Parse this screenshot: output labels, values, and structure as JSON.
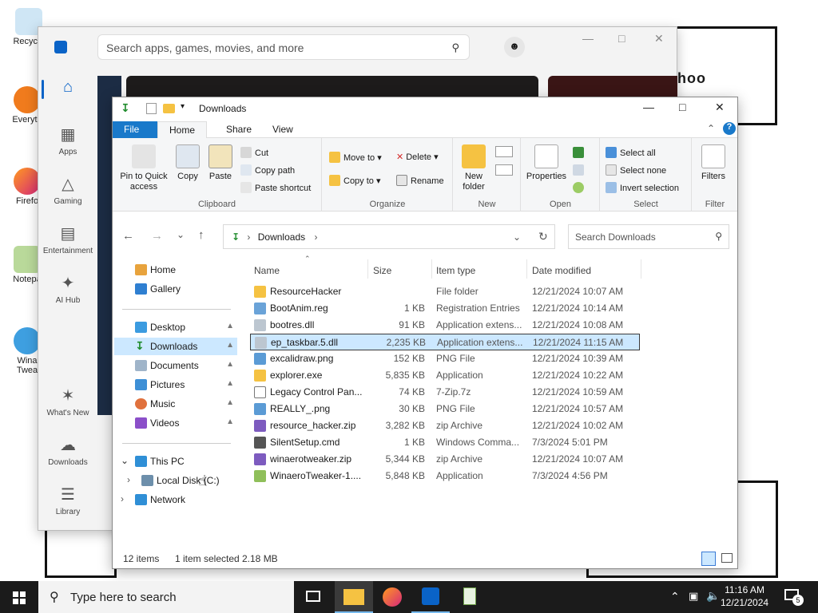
{
  "desktop": {
    "icons": [
      {
        "label": "Recycle",
        "icon": "recycle-bin-icon"
      },
      {
        "label": "Everyth",
        "icon": "everything-icon"
      },
      {
        "label": "Firefo",
        "icon": "firefox-icon"
      },
      {
        "label": "Notepa",
        "icon": "notepad-icon"
      },
      {
        "label": "Wina Twea",
        "icon": "winaero-icon"
      }
    ],
    "bg_text": "hoo"
  },
  "store": {
    "search_placeholder": "Search apps, games, movies, and more",
    "rail": [
      {
        "label": "",
        "icon": "home-icon"
      },
      {
        "label": "Apps",
        "icon": "apps-icon"
      },
      {
        "label": "Gaming",
        "icon": "gaming-icon"
      },
      {
        "label": "Entertainment",
        "icon": "entertainment-icon"
      },
      {
        "label": "AI Hub",
        "icon": "ai-hub-icon"
      },
      {
        "label": "What's New",
        "icon": "whats-new-icon"
      },
      {
        "label": "Downloads",
        "icon": "downloads-icon"
      },
      {
        "label": "Library",
        "icon": "library-icon"
      }
    ]
  },
  "explorer": {
    "title": "Downloads",
    "tabs": [
      "File",
      "Home",
      "Share",
      "View"
    ],
    "ribbon": {
      "clipboard": {
        "label": "Clipboard",
        "pin": "Pin to Quick access",
        "copy": "Copy",
        "paste": "Paste",
        "cut": "Cut",
        "copy_path": "Copy path",
        "paste_shortcut": "Paste shortcut"
      },
      "organize": {
        "label": "Organize",
        "move_to": "Move to",
        "copy_to": "Copy to",
        "delete": "Delete",
        "rename": "Rename"
      },
      "new": {
        "label": "New",
        "new_folder": "New folder"
      },
      "open": {
        "label": "Open",
        "properties": "Properties"
      },
      "select": {
        "label": "Select",
        "select_all": "Select all",
        "select_none": "Select none",
        "invert": "Invert selection"
      },
      "filter": {
        "label": "Filter",
        "filters": "Filters"
      }
    },
    "address": {
      "path": "Downloads",
      "search_placeholder": "Search Downloads"
    },
    "nav": {
      "home": "Home",
      "gallery": "Gallery",
      "desktop": "Desktop",
      "downloads": "Downloads",
      "documents": "Documents",
      "pictures": "Pictures",
      "music": "Music",
      "videos": "Videos",
      "this_pc": "This PC",
      "local_disk": "Local Disk (C:)",
      "network": "Network"
    },
    "columns": {
      "name": "Name",
      "size": "Size",
      "type": "Item type",
      "date": "Date modified"
    },
    "files": [
      {
        "name": "ResourceHacker",
        "size": "",
        "type": "File folder",
        "date": "12/21/2024 10:07 AM",
        "icon": "folder-icon"
      },
      {
        "name": "BootAnim.reg",
        "size": "1 KB",
        "type": "Registration Entries",
        "date": "12/21/2024 10:14 AM",
        "icon": "reg-file-icon"
      },
      {
        "name": "bootres.dll",
        "size": "91 KB",
        "type": "Application extens...",
        "date": "12/21/2024 10:08 AM",
        "icon": "dll-file-icon"
      },
      {
        "name": "ep_taskbar.5.dll",
        "size": "2,235 KB",
        "type": "Application extens...",
        "date": "12/21/2024 11:15 AM",
        "icon": "dll-file-icon"
      },
      {
        "name": "excalidraw.png",
        "size": "152 KB",
        "type": "PNG File",
        "date": "12/21/2024 10:39 AM",
        "icon": "image-file-icon"
      },
      {
        "name": "explorer.exe",
        "size": "5,835 KB",
        "type": "Application",
        "date": "12/21/2024 10:22 AM",
        "icon": "explorer-exe-icon"
      },
      {
        "name": "Legacy Control Pan...",
        "size": "74 KB",
        "type": "7-Zip.7z",
        "date": "12/21/2024 10:59 AM",
        "icon": "archive-file-icon"
      },
      {
        "name": "REALLY_.png",
        "size": "30 KB",
        "type": "PNG File",
        "date": "12/21/2024 10:57 AM",
        "icon": "image-file-icon"
      },
      {
        "name": "resource_hacker.zip",
        "size": "3,282 KB",
        "type": "zip Archive",
        "date": "12/21/2024 10:02 AM",
        "icon": "zip-file-icon"
      },
      {
        "name": "SilentSetup.cmd",
        "size": "1 KB",
        "type": "Windows Comma...",
        "date": "7/3/2024 5:01 PM",
        "icon": "cmd-file-icon"
      },
      {
        "name": "winaerotweaker.zip",
        "size": "5,344 KB",
        "type": "zip Archive",
        "date": "12/21/2024 10:07 AM",
        "icon": "zip-file-icon"
      },
      {
        "name": "WinaeroTweaker-1....",
        "size": "5,848 KB",
        "type": "Application",
        "date": "7/3/2024 4:56 PM",
        "icon": "app-file-icon"
      }
    ],
    "status": {
      "items": "12 items",
      "selected": "1 item selected",
      "size": "2.18 MB"
    }
  },
  "taskbar": {
    "search_placeholder": "Type here to search",
    "time": "11:16 AM",
    "date": "12/21/2024",
    "notifications": "5"
  }
}
